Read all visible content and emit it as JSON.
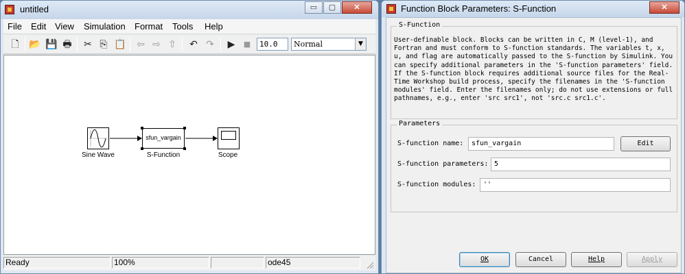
{
  "simulink": {
    "title": "untitled",
    "window_buttons": {
      "minimize": "▭",
      "maximize": "▢",
      "close": "✕"
    },
    "menu": [
      "File",
      "Edit",
      "View",
      "Simulation",
      "Format",
      "Tools",
      "Help"
    ],
    "toolbar": {
      "icons": {
        "new": "🗋",
        "open": "📂",
        "save": "💾",
        "print": "🖶",
        "cut": "✂",
        "copy": "⎘",
        "paste": "📋",
        "back": "⇦",
        "forward": "⇨",
        "up": "⇧",
        "undo": "↶",
        "redo": "↷",
        "start": "▶",
        "stop": "■"
      },
      "stop_time": "10.0",
      "sim_mode": "Normal"
    },
    "blocks": {
      "sine_wave": {
        "label": "Sine Wave"
      },
      "sfunction": {
        "label": "S-Function",
        "inner": "sfun_vargain"
      },
      "scope": {
        "label": "Scope"
      }
    },
    "status": {
      "state": "Ready",
      "zoom": "100%",
      "solver": "ode45"
    }
  },
  "dialog": {
    "title": "Function Block Parameters: S-Function",
    "close_label": "✕",
    "section1_title": "S-Function",
    "description": "User-definable block.  Blocks can be written in C, M (level-1), and Fortran and must conform to S-function standards.  The variables t, x, u, and flag are automatically passed to the S-function by Simulink.  You can specify additional parameters in the 'S-function parameters' field. If the S-function block requires additional source files for the Real-Time Workshop build process, specify the filenames in the 'S-function modules' field. Enter the filenames only; do not use extensions or full pathnames, e.g., enter 'src src1', not 'src.c src1.c'.",
    "section2_title": "Parameters",
    "fields": {
      "name": {
        "label": "S-function name:",
        "value": "sfun_vargain"
      },
      "params": {
        "label": "S-function parameters:",
        "value": "5"
      },
      "modules": {
        "label": "S-function modules:",
        "value": "''"
      }
    },
    "buttons": {
      "edit": "Edit",
      "ok": "OK",
      "cancel": "Cancel",
      "help": "Help",
      "apply": "Apply"
    }
  }
}
